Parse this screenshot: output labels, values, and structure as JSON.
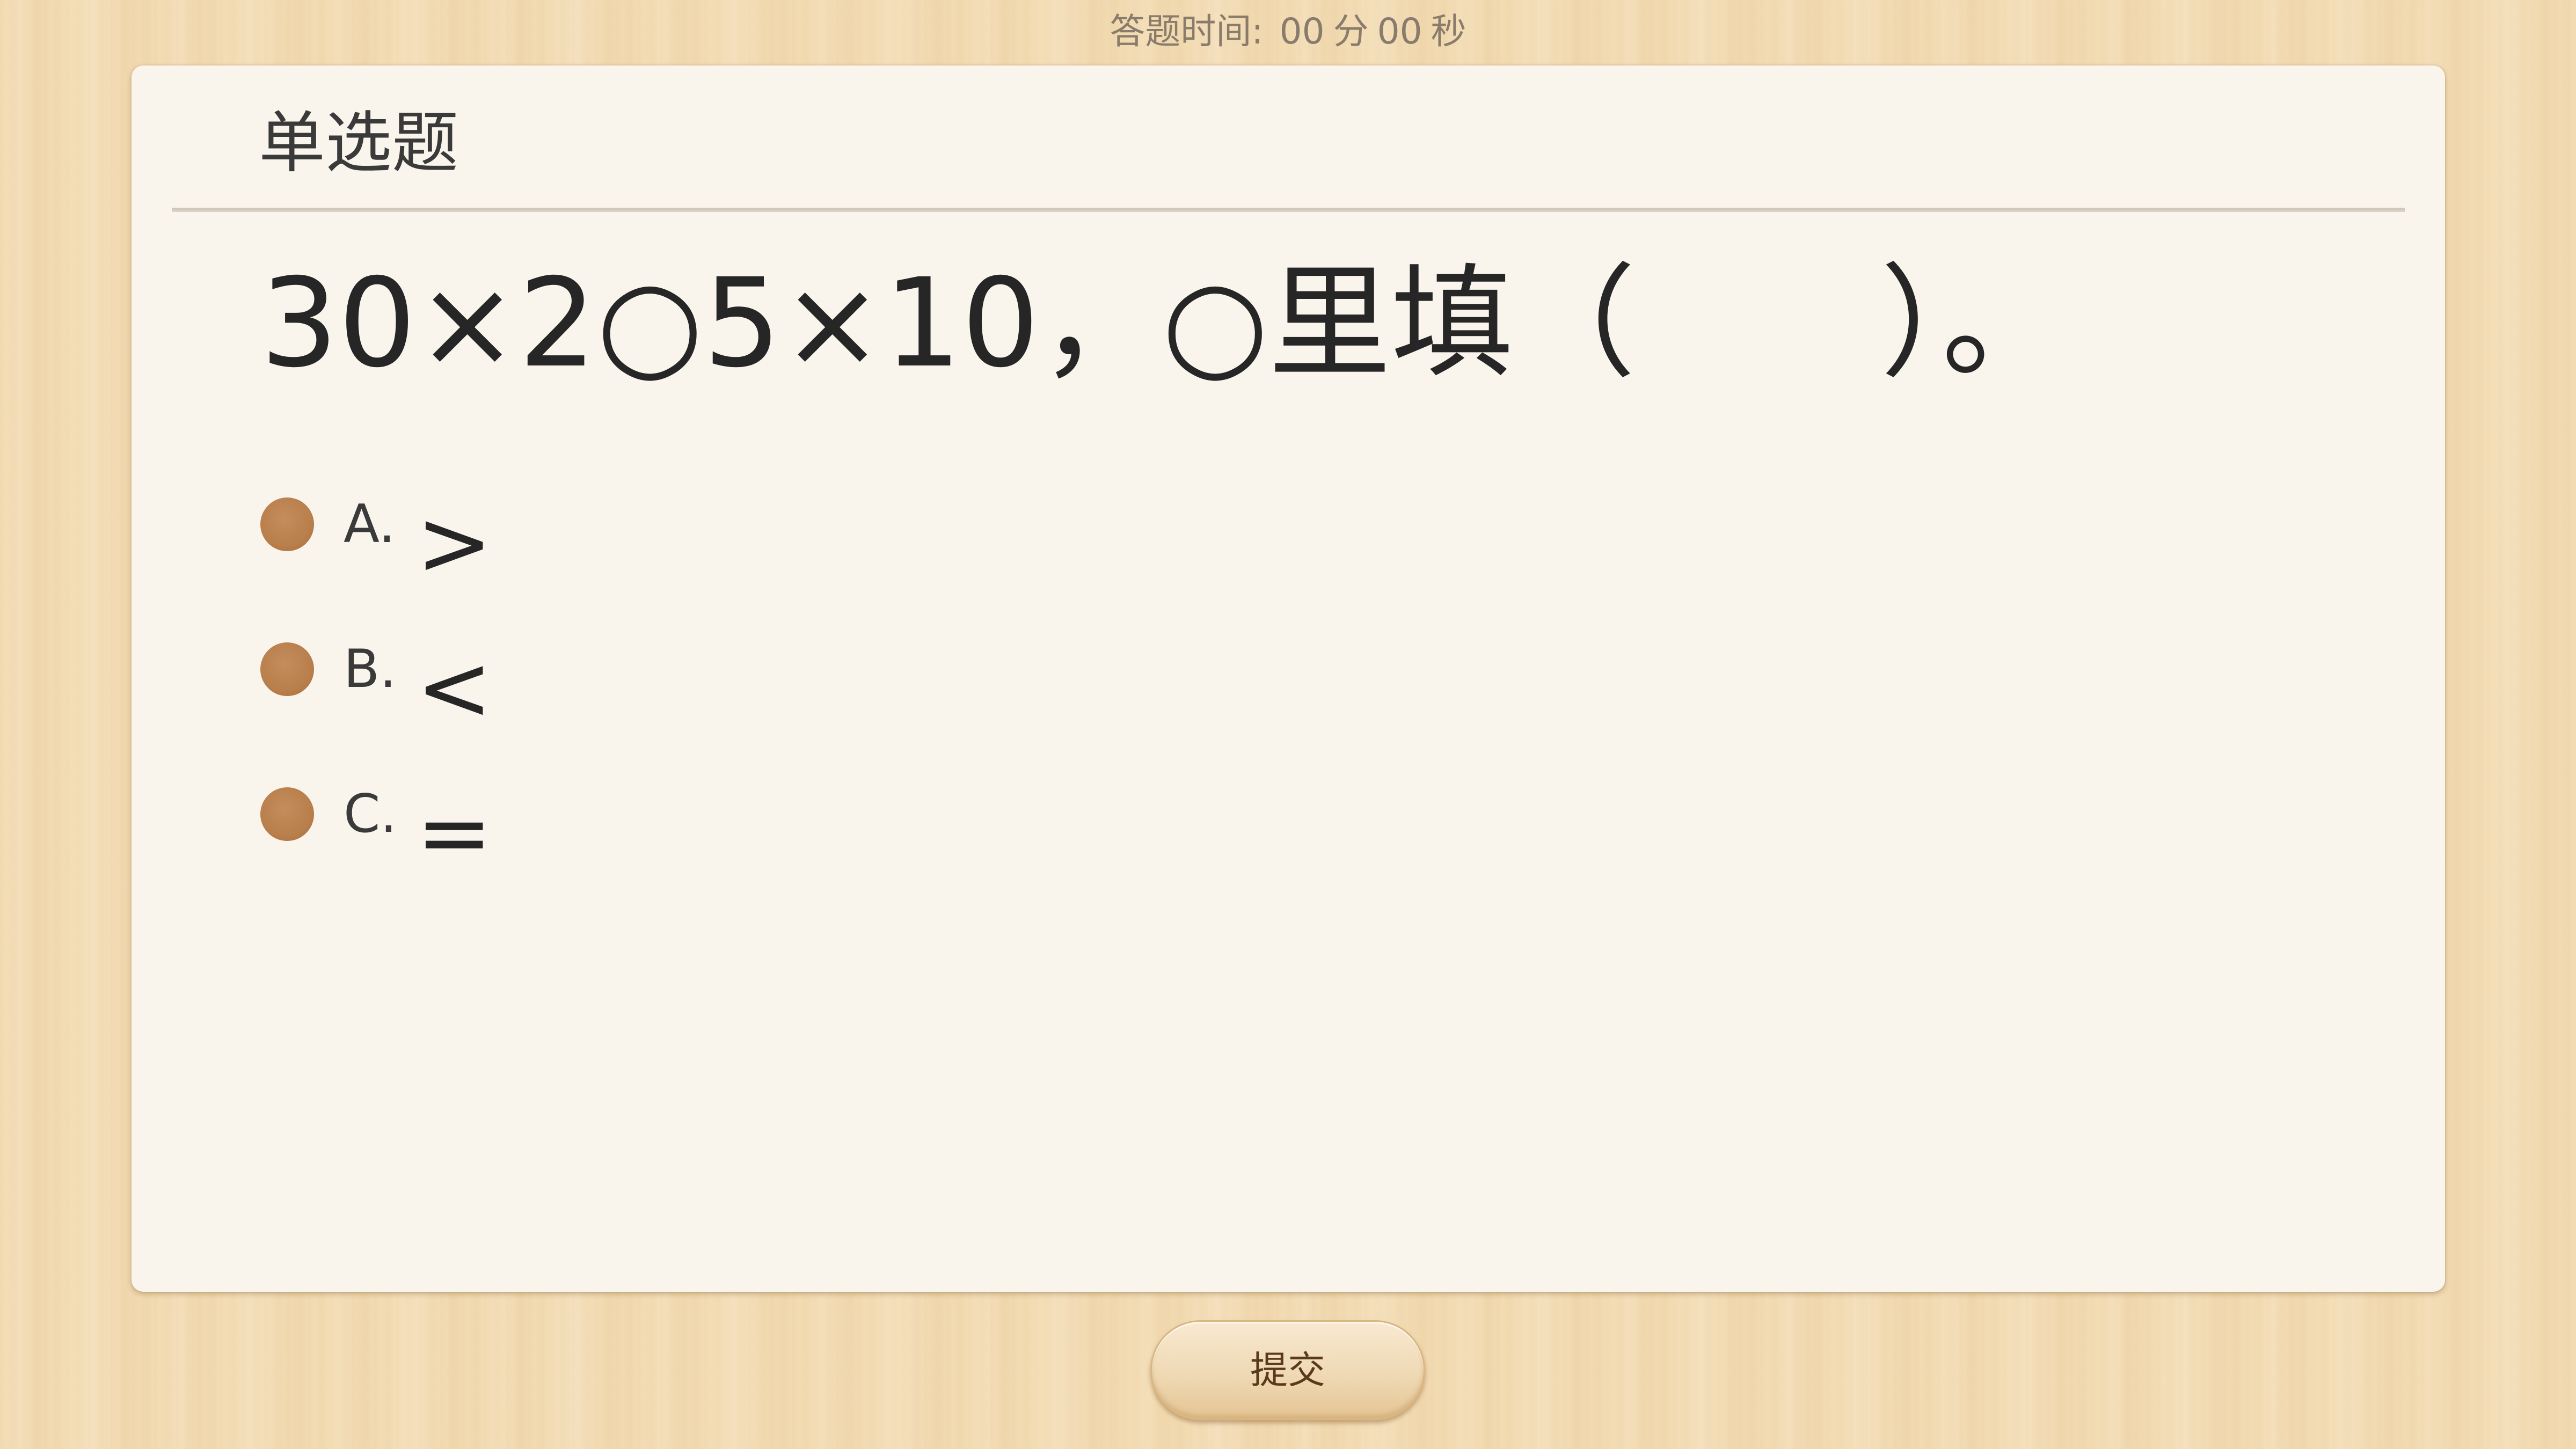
{
  "timer": {
    "label": "答题时间:",
    "minutes": "00",
    "minutes_unit": "分",
    "seconds": "00",
    "seconds_unit": "秒"
  },
  "card": {
    "title": "单选题",
    "question": "30×2○5×10，○里填（　　）。",
    "options": [
      {
        "letter": "A.",
        "text": ">"
      },
      {
        "letter": "B.",
        "text": "<"
      },
      {
        "letter": "C.",
        "text": "="
      }
    ]
  },
  "submit_label": "提交",
  "colors": {
    "radio": "#b97f4c",
    "card_background": "#faf5ec",
    "wood_background": "#f3dcb3"
  },
  "icons": {
    "option_marker": "radio-dot-icon"
  }
}
